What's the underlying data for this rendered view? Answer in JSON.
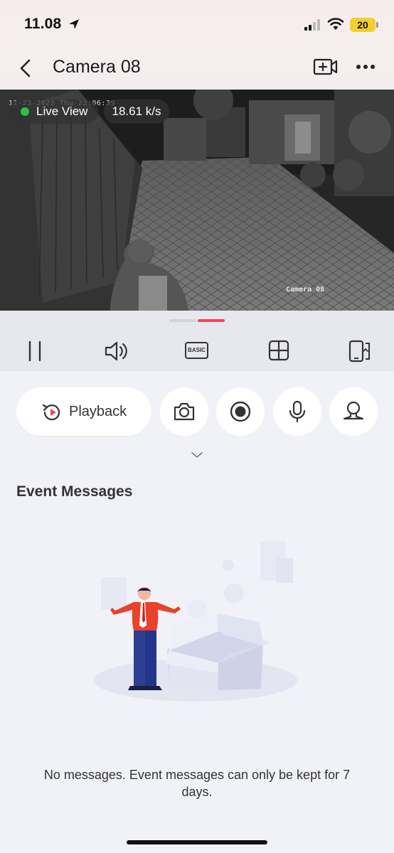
{
  "status_bar": {
    "time": "11.08",
    "battery": "20"
  },
  "nav": {
    "title": "Camera 08"
  },
  "video": {
    "osd_timestamp": "11-23-2023 Thu 23:06:39",
    "osd_camera_name": "Camera 08",
    "live_label": "Live View",
    "bitrate": "18.61 k/s",
    "live_color": "#2bc24a"
  },
  "controls": {
    "icons": [
      "pause-icon",
      "volume-icon",
      "basic-quality-icon",
      "grid-view-icon",
      "rotate-screen-icon"
    ],
    "quality_label": "BASIC"
  },
  "actions": {
    "playback_label": "Playback",
    "icons": [
      "camera-snapshot-icon",
      "record-icon",
      "microphone-icon",
      "ptz-icon"
    ]
  },
  "events": {
    "title": "Event Messages",
    "empty_message": "No messages. Event messages can only be kept for 7 days."
  },
  "colors": {
    "accent": "#f0465a",
    "background": "#f1f2f8"
  }
}
